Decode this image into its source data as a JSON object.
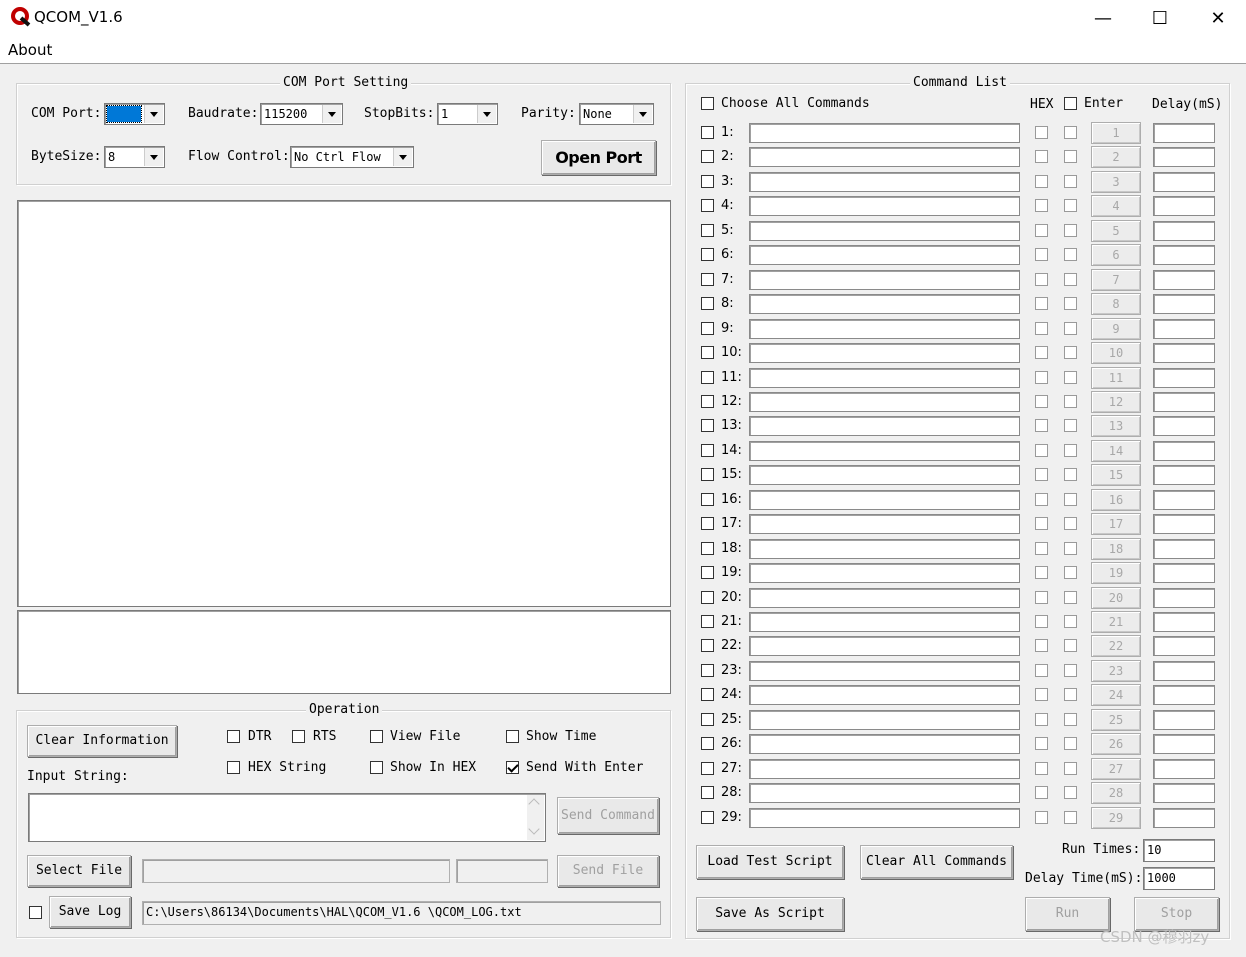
{
  "window": {
    "title": "QCOM_V1.6",
    "minimize_icon": "minimize-icon",
    "maximize_icon": "maximize-icon",
    "close_icon": "close-icon"
  },
  "menu": {
    "about": "About"
  },
  "port_setting": {
    "title": "COM Port Setting",
    "com_port_label": "COM Port:",
    "com_port_value": "",
    "baudrate_label": "Baudrate:",
    "baudrate_value": "115200",
    "stopbits_label": "StopBits:",
    "stopbits_value": "1",
    "parity_label": "Parity:",
    "parity_value": "None",
    "bytesize_label": "ByteSize:",
    "bytesize_value": "8",
    "flow_label": "Flow Control:",
    "flow_value": "No Ctrl Flow",
    "open_port": "Open Port"
  },
  "operation": {
    "title": "Operation",
    "clear_info": "Clear Information",
    "dtr": "DTR",
    "rts": "RTS",
    "view_file": "View File",
    "show_time": "Show Time",
    "hex_string": "HEX String",
    "show_in_hex": "Show In HEX",
    "send_with_enter": "Send With Enter",
    "send_with_enter_checked": true,
    "input_string_label": "Input String:",
    "send_command": "Send Command",
    "select_file": "Select File",
    "send_file": "Send File",
    "save_log": "Save Log",
    "log_path": "C:\\Users\\86134\\Documents\\HAL\\QCOM_V1.6 \\QCOM_LOG.txt"
  },
  "command_list": {
    "title": "Command List",
    "choose_all": "Choose All Commands",
    "hex_header": "HEX",
    "enter_header": "Enter",
    "delay_header": "Delay(mS)",
    "rows": [
      {
        "label": "1:",
        "btn": "1"
      },
      {
        "label": "2:",
        "btn": "2"
      },
      {
        "label": "3:",
        "btn": "3"
      },
      {
        "label": "4:",
        "btn": "4"
      },
      {
        "label": "5:",
        "btn": "5"
      },
      {
        "label": "6:",
        "btn": "6"
      },
      {
        "label": "7:",
        "btn": "7"
      },
      {
        "label": "8:",
        "btn": "8"
      },
      {
        "label": "9:",
        "btn": "9"
      },
      {
        "label": "10:",
        "btn": "10"
      },
      {
        "label": "11:",
        "btn": "11"
      },
      {
        "label": "12:",
        "btn": "12"
      },
      {
        "label": "13:",
        "btn": "13"
      },
      {
        "label": "14:",
        "btn": "14"
      },
      {
        "label": "15:",
        "btn": "15"
      },
      {
        "label": "16:",
        "btn": "16"
      },
      {
        "label": "17:",
        "btn": "17"
      },
      {
        "label": "18:",
        "btn": "18"
      },
      {
        "label": "19:",
        "btn": "19"
      },
      {
        "label": "20:",
        "btn": "20"
      },
      {
        "label": "21:",
        "btn": "21"
      },
      {
        "label": "22:",
        "btn": "22"
      },
      {
        "label": "23:",
        "btn": "23"
      },
      {
        "label": "24:",
        "btn": "24"
      },
      {
        "label": "25:",
        "btn": "25"
      },
      {
        "label": "26:",
        "btn": "26"
      },
      {
        "label": "27:",
        "btn": "27"
      },
      {
        "label": "28:",
        "btn": "28"
      },
      {
        "label": "29:",
        "btn": "29"
      }
    ],
    "load_script": "Load Test Script",
    "clear_all": "Clear All Commands",
    "save_script": "Save As Script",
    "run_times_label": "Run Times:",
    "run_times_value": "10",
    "delay_time_label": "Delay Time(mS):",
    "delay_time_value": "1000",
    "run": "Run",
    "stop": "Stop"
  },
  "watermark": "CSDN @穆羽zy"
}
